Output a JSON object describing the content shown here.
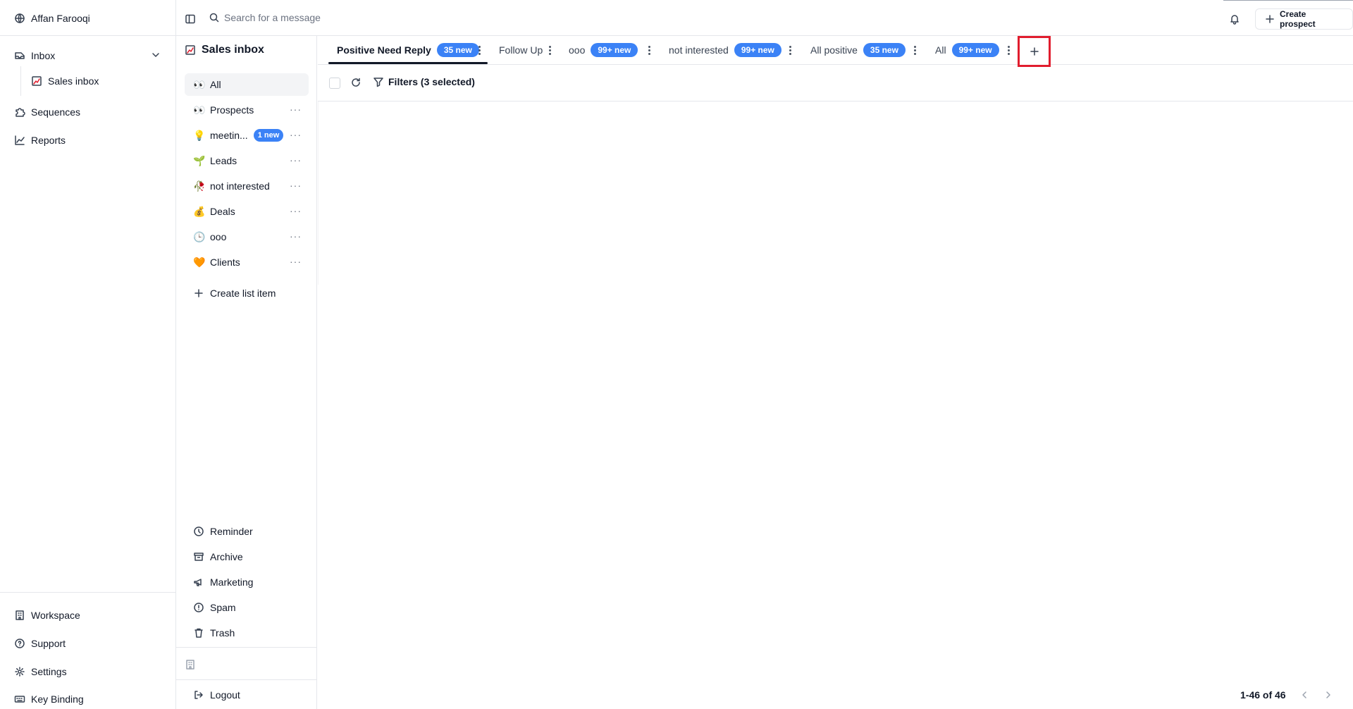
{
  "user": {
    "name": "Affan Farooqi",
    "icon": "globe-icon"
  },
  "nav": {
    "inbox": "Inbox",
    "sales_inbox": "Sales inbox",
    "sequences": "Sequences",
    "reports": "Reports",
    "workspace": "Workspace",
    "support": "Support",
    "settings": "Settings",
    "key_binding": "Key Binding"
  },
  "search": {
    "placeholder": "Search for a message"
  },
  "header": {
    "create_prospect": "Create prospect"
  },
  "inbox_panel": {
    "title": "Sales inbox",
    "items": [
      {
        "label": "All",
        "emoji": "👀"
      },
      {
        "label": "Prospects",
        "emoji": "👀"
      },
      {
        "label": "meetin...",
        "emoji": "💡",
        "badge": "1 new"
      },
      {
        "label": "Leads",
        "emoji": "🌱"
      },
      {
        "label": "not interested",
        "emoji": "🥀"
      },
      {
        "label": "Deals",
        "emoji": "💰"
      },
      {
        "label": "ooo",
        "emoji": "🕒"
      },
      {
        "label": "Clients",
        "emoji": "🧡"
      }
    ],
    "create_list_item": "Create list item",
    "bottom": {
      "reminder": "Reminder",
      "archive": "Archive",
      "marketing": "Marketing",
      "spam": "Spam",
      "trash": "Trash",
      "logout": "Logout"
    }
  },
  "tabs": [
    {
      "label": "Positive Need Reply",
      "badge": "35 new"
    },
    {
      "label": "Follow Up"
    },
    {
      "label": "ooo",
      "badge": "99+ new"
    },
    {
      "label": "not interested",
      "badge": "99+ new"
    },
    {
      "label": "All positive",
      "badge": "35 new"
    },
    {
      "label": "All",
      "badge": "99+ new"
    }
  ],
  "filters": {
    "label": "Filters (3 selected)"
  },
  "pagination": {
    "range": "1-46 of 46"
  },
  "colors": {
    "accent": "#3b82f6",
    "highlight": "#e11d2e"
  }
}
